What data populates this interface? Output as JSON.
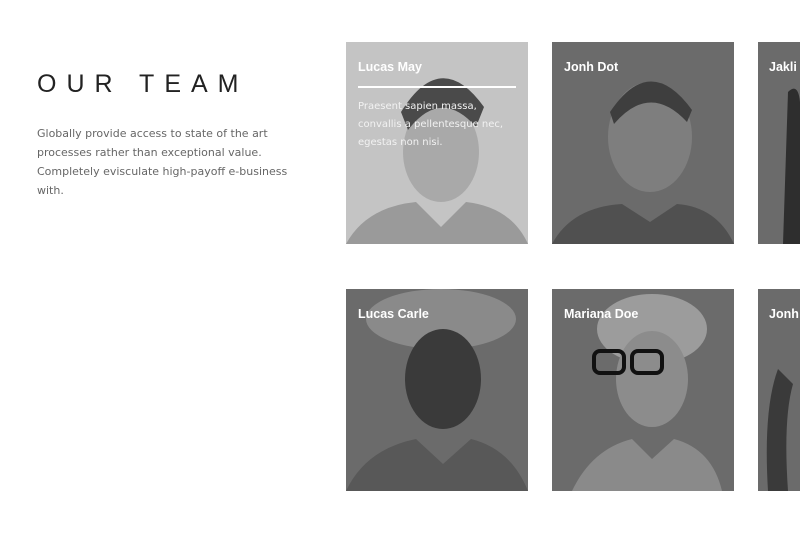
{
  "section": {
    "title": "OUR TEAM",
    "intro": "Globally provide access to state of the art processes rather than exceptional value. Completely evisculate high-payoff e-business with."
  },
  "team": [
    {
      "name": "Lucas May",
      "description": "Praesent sapien massa, convallis a pellentesque nec, egestas non nisi.",
      "active": true
    },
    {
      "name": "Jonh Dot"
    },
    {
      "name": "Jakli"
    },
    {
      "name": "Lucas Carle"
    },
    {
      "name": "Mariana Doe"
    },
    {
      "name": "Jonh"
    }
  ],
  "colors": {
    "overlay_active": "#c4c4c4",
    "overlay": "#6b6b6b",
    "title": "#222222",
    "text": "#666666"
  }
}
